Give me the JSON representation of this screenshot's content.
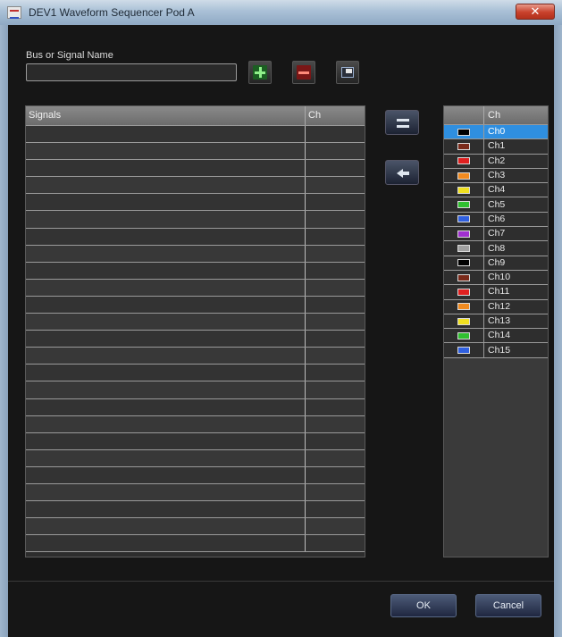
{
  "window": {
    "title": "DEV1 Waveform Sequencer Pod A",
    "close_label": "✕"
  },
  "bus": {
    "label": "Bus or Signal Name",
    "value": "",
    "placeholder": ""
  },
  "toolbar": {
    "add_icon": "plus-icon",
    "remove_icon": "minus-icon",
    "edit_icon": "edit-icon"
  },
  "signals": {
    "headers": [
      "Signals",
      "Ch"
    ],
    "row_count": 25
  },
  "transfer": {
    "swap_icon": "swap-icon",
    "move_left_icon": "arrow-left-icon"
  },
  "channels": {
    "header": "Ch",
    "selected": "Ch0",
    "items": [
      {
        "label": "Ch0",
        "color": "#000000"
      },
      {
        "label": "Ch1",
        "color": "#7a2a1a"
      },
      {
        "label": "Ch2",
        "color": "#e02020"
      },
      {
        "label": "Ch3",
        "color": "#f08a20"
      },
      {
        "label": "Ch4",
        "color": "#f0e020"
      },
      {
        "label": "Ch5",
        "color": "#30c030"
      },
      {
        "label": "Ch6",
        "color": "#3060e0"
      },
      {
        "label": "Ch7",
        "color": "#a030d0"
      },
      {
        "label": "Ch8",
        "color": "#a0a0a0"
      },
      {
        "label": "Ch9",
        "color": "#000000"
      },
      {
        "label": "Ch10",
        "color": "#7a2a1a"
      },
      {
        "label": "Ch11",
        "color": "#e02020"
      },
      {
        "label": "Ch12",
        "color": "#f08a20"
      },
      {
        "label": "Ch13",
        "color": "#f0e020"
      },
      {
        "label": "Ch14",
        "color": "#30c030"
      },
      {
        "label": "Ch15",
        "color": "#3060e0"
      }
    ]
  },
  "footer": {
    "ok_label": "OK",
    "cancel_label": "Cancel"
  }
}
